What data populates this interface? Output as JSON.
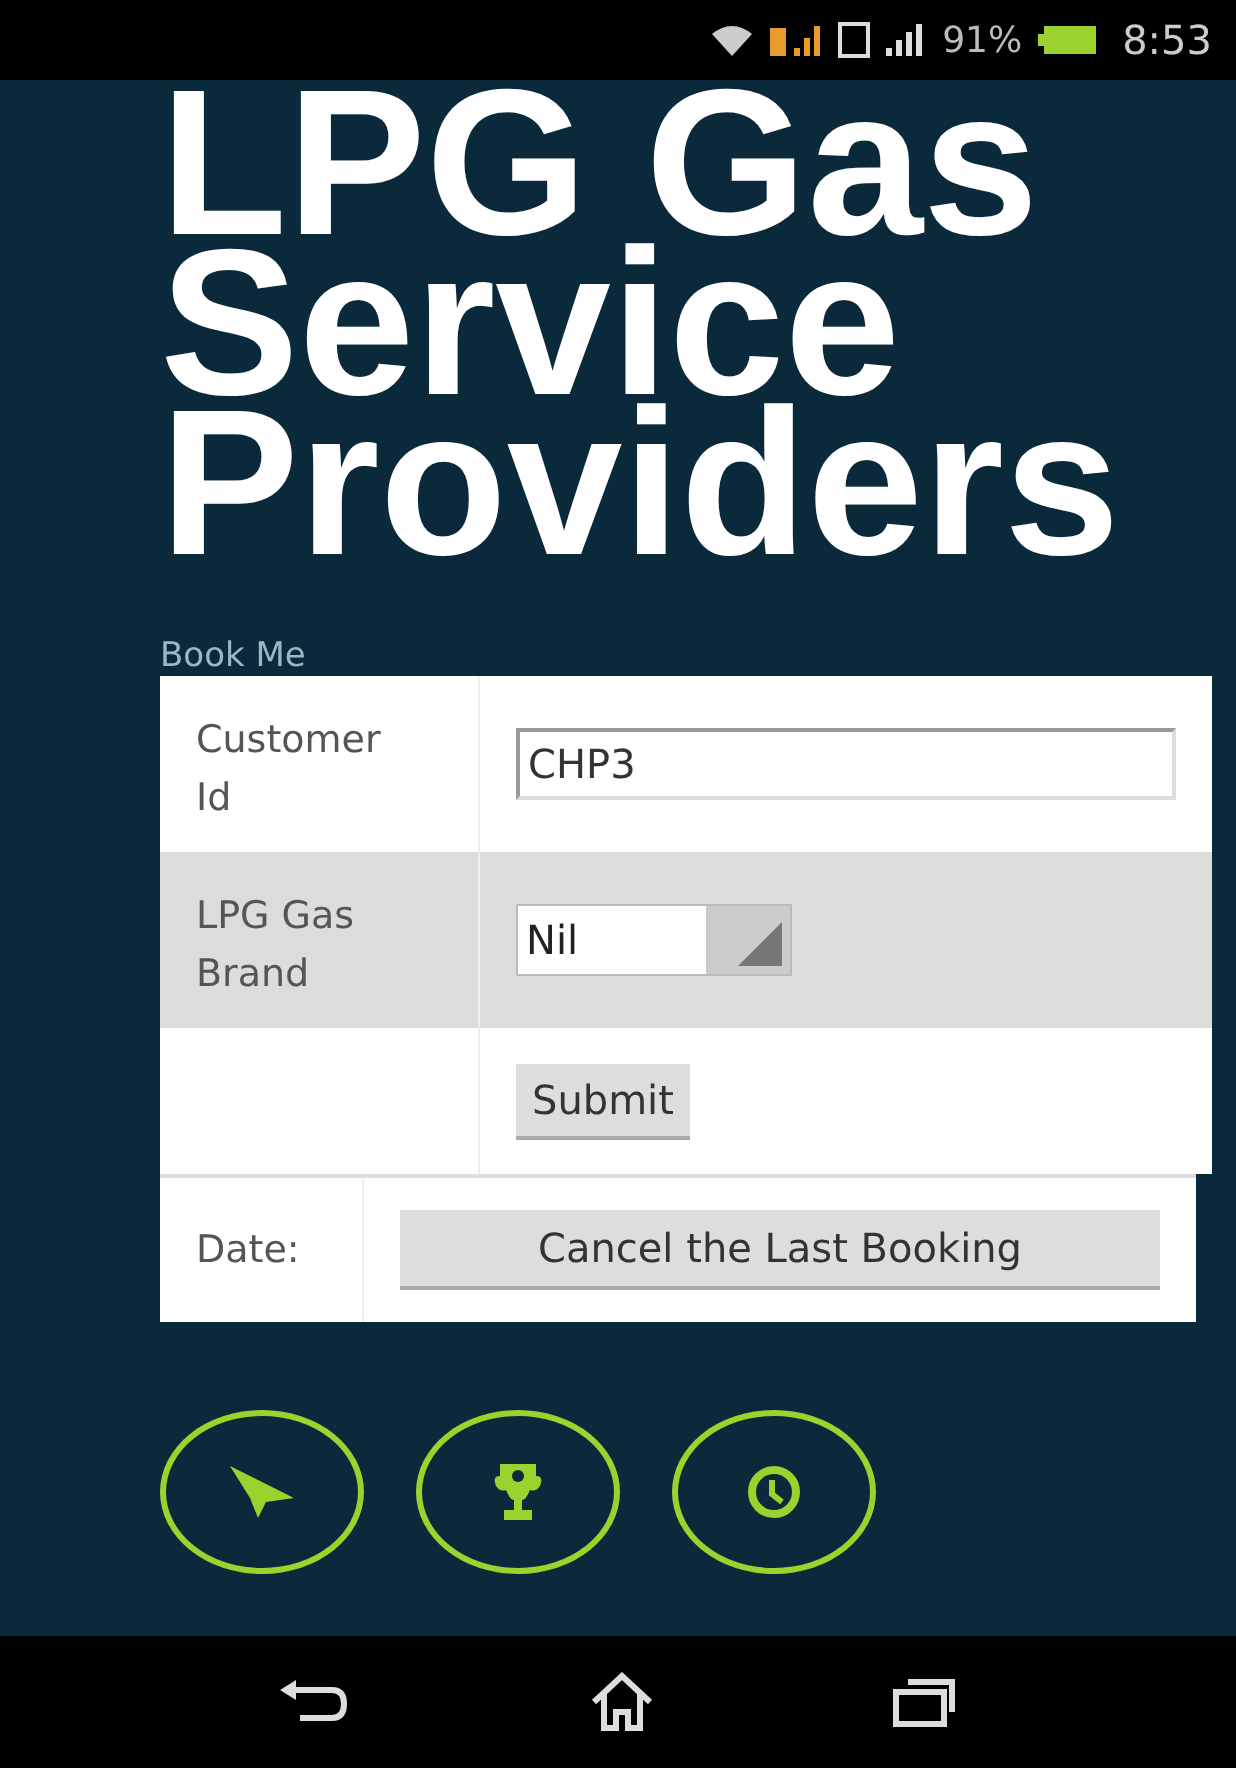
{
  "status_bar": {
    "battery": "91%",
    "time": "8:53"
  },
  "title_lines": [
    "LPG Gas",
    "Service",
    "Providers"
  ],
  "form": {
    "legend": "Book Me",
    "rows": [
      {
        "kind": "input",
        "label": "Customer Id",
        "value": "CHP3",
        "shaded": false
      },
      {
        "kind": "select",
        "label": "LPG Gas Brand",
        "value": "Nil",
        "shaded": true
      },
      {
        "kind": "button",
        "label": "",
        "value": "Submit",
        "shaded": false
      }
    ]
  },
  "date_row": {
    "label": "Date:",
    "button": "Cancel the Last Booking"
  },
  "bottom_buttons": [
    {
      "kind": "plane"
    },
    {
      "kind": "trophy"
    },
    {
      "kind": "clock"
    }
  ]
}
